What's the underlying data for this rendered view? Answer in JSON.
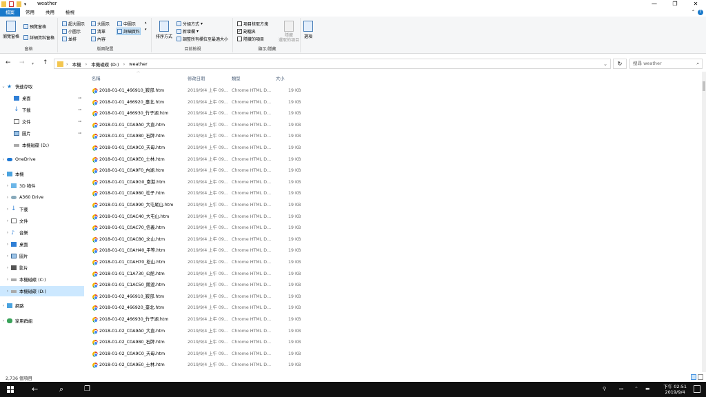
{
  "window": {
    "title": "weather",
    "controls": [
      "—",
      "❐",
      "✕"
    ]
  },
  "ribbon_tabs": [
    "檔案",
    "常用",
    "共用",
    "檢視"
  ],
  "ribbon": {
    "panes": {
      "label": "窗格",
      "navigation_pane": "瀏覽窗格",
      "preview_pane": "預覽窗格",
      "details_pane": "詳細資料窗格"
    },
    "layout": {
      "label": "版面配置",
      "items": [
        "超大圖示",
        "大圖示",
        "中圖示",
        "小圖示",
        "清單",
        "詳細資料",
        "並排",
        "內容"
      ],
      "selected": "詳細資料"
    },
    "current_view": {
      "label": "目前檢視",
      "sort_by": "排序方式",
      "group_by": "分組方式",
      "add_columns": "新增欄",
      "size_all_columns": "調整所有欄位至最適大小"
    },
    "show_hide": {
      "label": "顯示/隱藏",
      "item_check_boxes": "項目核取方塊",
      "file_name_extensions": "副檔名",
      "hidden_items": "隱藏的項目",
      "hide_selected": "隱藏\n選取的項目",
      "options": "選項",
      "checks": {
        "item_check_boxes": false,
        "file_name_extensions": true,
        "hidden_items": false
      }
    }
  },
  "address": {
    "crumbs": [
      "本機",
      "本機磁碟 (D:)",
      "weather"
    ],
    "search_placeholder": "搜尋 weather"
  },
  "nav": {
    "quick_access": "快速存取",
    "quick_items": [
      "桌面",
      "下載",
      "文件",
      "圖片",
      "本機磁碟 (D:)"
    ],
    "onedrive": "OneDrive",
    "this_pc": "本機",
    "pc_items": [
      "3D 物件",
      "A360 Drive",
      "下載",
      "文件",
      "音樂",
      "桌面",
      "圖片",
      "影片",
      "本機磁碟 (C:)",
      "本機磁碟 (D:)"
    ],
    "network": "網路",
    "homegroup": "家用群組"
  },
  "columns": {
    "name": "名稱",
    "date": "修改日期",
    "type": "類型",
    "size": "大小"
  },
  "files": [
    "2018-01-01_466910_鞍部.htm",
    "2018-01-01_466920_臺北.htm",
    "2018-01-01_466930_竹子湖.htm",
    "2018-01-01_C0A9A0_大直.htm",
    "2018-01-01_C0A980_石牌.htm",
    "2018-01-01_C0A9C0_天母.htm",
    "2018-01-01_C0A9E0_士林.htm",
    "2018-01-01_C0A9F0_內湖.htm",
    "2018-01-01_C0A9G0_南港.htm",
    "2018-01-01_C0A980_社子.htm",
    "2018-01-01_C0A990_大屯尾山.htm",
    "2018-01-01_C0AC40_大屯山.htm",
    "2018-01-01_C0AC70_信義.htm",
    "2018-01-01_C0AC80_文山.htm",
    "2018-01-01_C0AH40_平等.htm",
    "2018-01-01_C0AH70_松山.htm",
    "2018-01-01_C1A730_公館.htm",
    "2018-01-01_C1AC50_關渡.htm",
    "2018-01-02_466910_鞍部.htm",
    "2018-01-02_466920_臺北.htm",
    "2018-01-02_466930_竹子湖.htm",
    "2018-01-02_C0A9A0_大直.htm",
    "2018-01-02_C0A980_石牌.htm",
    "2018-01-02_C0A9C0_天母.htm",
    "2018-01-02_C0A9E0_士林.htm"
  ],
  "file_date": "2019/9/4 上午 09...",
  "file_type": "Chrome HTML D...",
  "file_size": "19 KB",
  "status": {
    "count": "2,736 個項目"
  },
  "taskbar": {
    "time": "下午 02:51",
    "date": "2019/9/4"
  },
  "colors": {
    "accent": "#1979ca",
    "selection": "#cce8ff",
    "taskbar": "#101010"
  }
}
